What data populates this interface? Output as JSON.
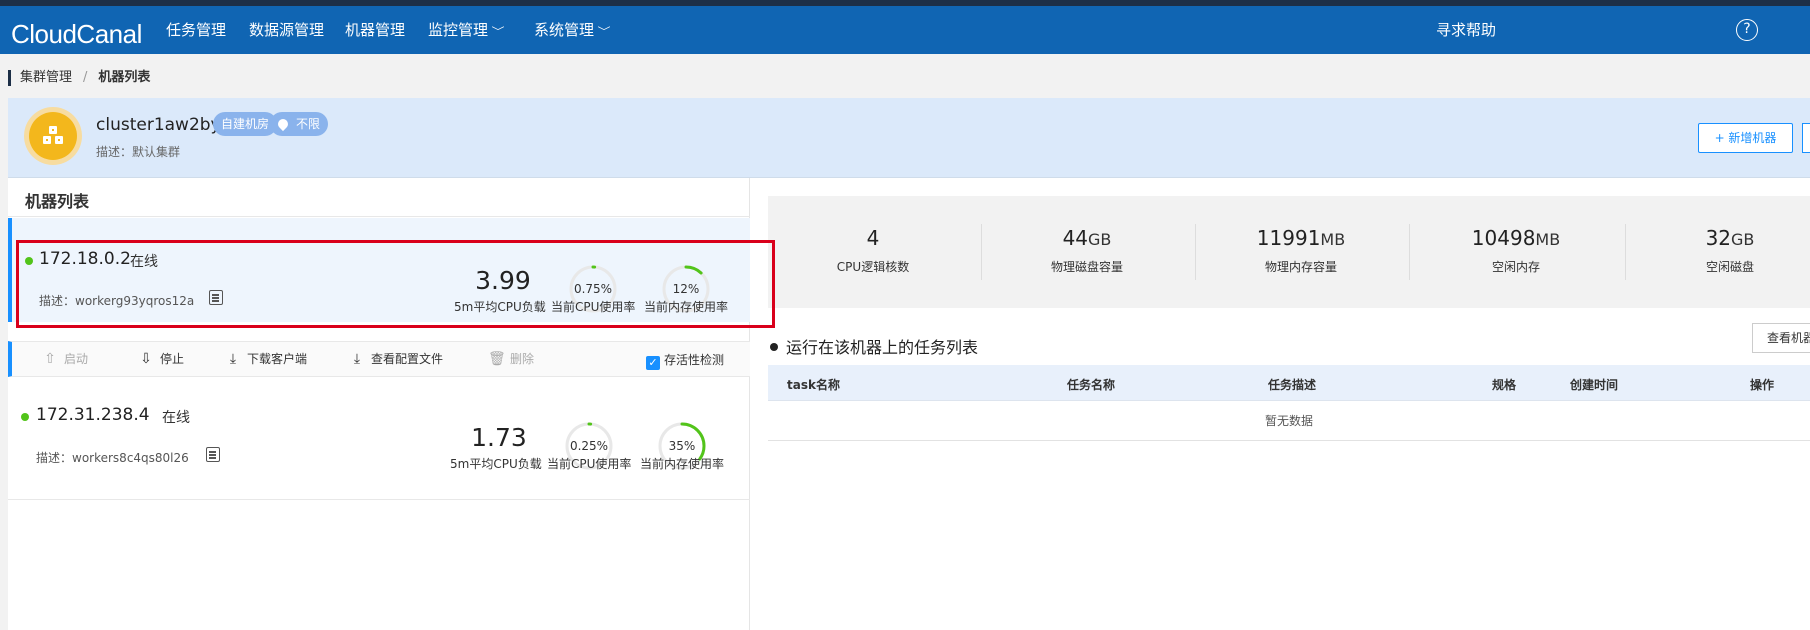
{
  "nav": {
    "logo": "CloudCanal",
    "items": [
      {
        "label": "任务管理"
      },
      {
        "label": "数据源管理"
      },
      {
        "label": "机器管理"
      },
      {
        "label": "监控管理",
        "dropdown": true
      },
      {
        "label": "系统管理",
        "dropdown": true
      }
    ],
    "help_label": "寻求帮助",
    "help_icon": "?"
  },
  "breadcrumb": {
    "items": [
      "集群管理",
      "机器列表"
    ],
    "separator": "/"
  },
  "cluster": {
    "name": "cluster1aw2byj490",
    "tag_room": "自建机房",
    "tag_region": "不限",
    "description": "描述：默认集群",
    "add_button": "+ 新增机器"
  },
  "machine_list": {
    "title": "机器列表",
    "machines": [
      {
        "ip": "172.18.0.2",
        "status": "在线",
        "description": "描述：workerg93yqros12a",
        "cpu_load": "3.99",
        "cpu_usage_text": "0.75%",
        "cpu_usage": 0.0075,
        "mem_usage_text": "12%",
        "mem_usage": 0.12,
        "selected": true
      },
      {
        "ip": "172.31.238.4",
        "status": "在线",
        "description": "描述：workers8c4qs80l26",
        "cpu_load": "1.73",
        "cpu_usage_text": "0.25%",
        "cpu_usage": 0.0025,
        "mem_usage_text": "35%",
        "mem_usage": 0.35,
        "selected": false
      }
    ],
    "labels": {
      "cpu_load": "5m平均CPU负载",
      "cpu_usage": "当前CPU使用率",
      "mem_usage": "当前内存使用率"
    },
    "actions": {
      "start": "启动",
      "stop": "停止",
      "download": "下载客户端",
      "view_config": "查看配置文件",
      "delete": "删除",
      "liveness": "存活性检测",
      "liveness_checked": true
    }
  },
  "stats": [
    {
      "value": "4",
      "unit": "",
      "label": "CPU逻辑核数"
    },
    {
      "value": "44",
      "unit": "GB",
      "label": "物理磁盘容量"
    },
    {
      "value": "11991",
      "unit": "MB",
      "label": "物理内存容量"
    },
    {
      "value": "10498",
      "unit": "MB",
      "label": "空闲内存"
    },
    {
      "value": "32",
      "unit": "GB",
      "label": "空闲磁盘"
    }
  ],
  "tasks": {
    "title": "运行在该机器上的任务列表",
    "view_button": "查看机器",
    "columns": [
      "task名称",
      "任务名称",
      "任务描述",
      "规格",
      "创建时间",
      "操作"
    ],
    "empty_text": "暂无数据"
  },
  "colors": {
    "nav_bg": "#1065b3",
    "accent": "#1890ff",
    "online": "#52c41a",
    "gauge": "#52c41a",
    "highlight": "#d9001b"
  }
}
